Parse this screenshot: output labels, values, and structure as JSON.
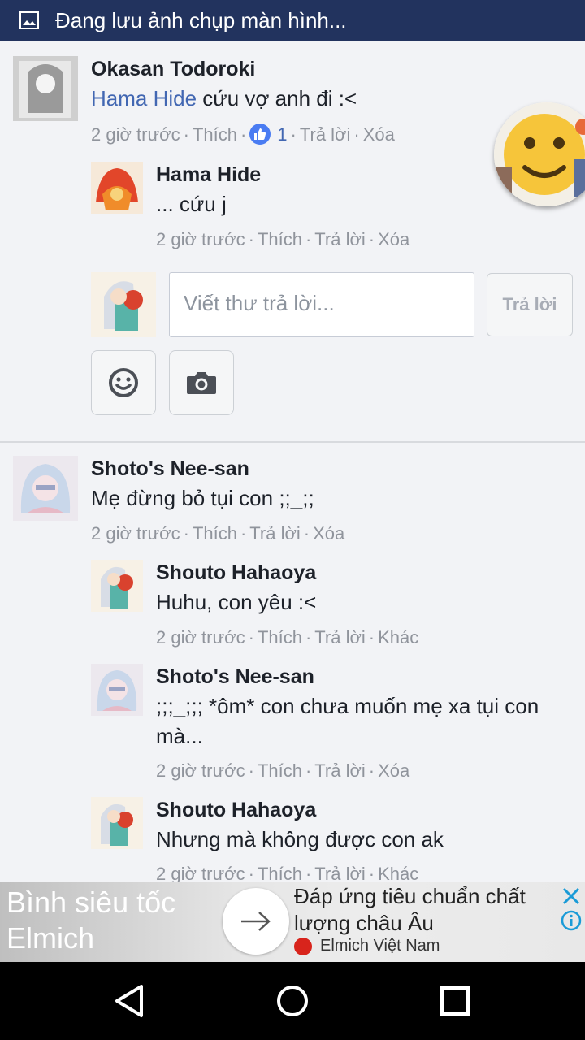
{
  "status_bar": {
    "text": "Đang lưu ảnh chụp màn hình..."
  },
  "comments": {
    "c1": {
      "author": "Okasan Todoroki",
      "mention": "Hama Hide",
      "text": " cứu vợ anh đi :<",
      "time": "2 giờ trước",
      "like": "Thích",
      "like_count": "1",
      "reply": "Trả lời",
      "delete": "Xóa"
    },
    "c1r1": {
      "author": "Hama Hide",
      "text": "... cứu j",
      "time": "2 giờ trước",
      "like": "Thích",
      "reply": "Trả lời",
      "delete": "Xóa"
    },
    "c2": {
      "author": "Shoto's Nee-san",
      "text": "Mẹ đừng bỏ tụi con ;;_;;",
      "time": "2 giờ trước",
      "like": "Thích",
      "reply": "Trả lời",
      "delete": "Xóa"
    },
    "c2r1": {
      "author": "Shouto Hahaoya",
      "text": "Huhu, con yêu :<",
      "time": "2 giờ trước",
      "like": "Thích",
      "reply": "Trả lời",
      "more": "Khác"
    },
    "c2r2": {
      "author": "Shoto's Nee-san",
      "text": ";;;_;;; *ôm* con chưa muốn mẹ xa tụi con mà...",
      "time": "2 giờ trước",
      "like": "Thích",
      "reply": "Trả lời",
      "delete": "Xóa"
    },
    "c2r3": {
      "author": "Shouto Hahaoya",
      "text": "Nhưng mà không được con ak",
      "time": "2 giờ trước",
      "like": "Thích",
      "reply": "Trả lời",
      "more": "Khác"
    }
  },
  "reply_box": {
    "placeholder": "Viết thư trả lời...",
    "submit_label": "Trả lời",
    "emoji_icon": "smiley-icon",
    "camera_icon": "camera-icon"
  },
  "ad": {
    "title": "Bình siêu tốc Elmich",
    "description": "Đáp ứng tiêu chuẩn chất lượng châu Âu",
    "brand": "Elmich Việt Nam"
  },
  "colors": {
    "status_bar": "#22335e",
    "link": "#4267b2",
    "meta": "#90949c",
    "background": "#f2f3f6"
  }
}
